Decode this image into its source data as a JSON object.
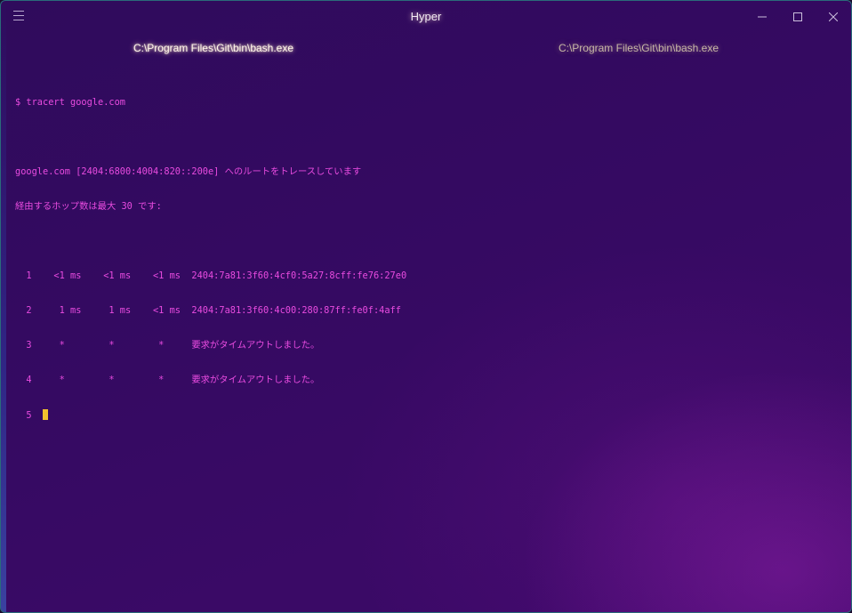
{
  "window": {
    "title": "Hyper"
  },
  "tabs": [
    {
      "label": "C:\\Program Files\\Git\\bin\\bash.exe",
      "active": true
    },
    {
      "label": "C:\\Program Files\\Git\\bin\\bash.exe",
      "active": false
    }
  ],
  "terminal": {
    "command": "$ tracert google.com",
    "route_header": "google.com [2404:6800:4004:820::200e] へのルートをトレースしています",
    "max_hops": "経由するホップ数は最大 30 です:",
    "hops": [
      "  1    <1 ms    <1 ms    <1 ms  2404:7a81:3f60:4cf0:5a27:8cff:fe76:27e0",
      "  2     1 ms     1 ms    <1 ms  2404:7a81:3f60:4c00:280:87ff:fe0f:4aff",
      "  3     *        *        *     要求がタイムアウトしました。",
      "  4     *        *        *     要求がタイムアウトしました。"
    ],
    "current_hop": "  5  "
  },
  "icons": {
    "menu": "hamburger-icon",
    "minimize": "minimize-icon",
    "maximize": "maximize-icon",
    "close": "close-icon"
  },
  "colors": {
    "terminal_text": "#e94be0",
    "cursor": "#f2c12e"
  }
}
